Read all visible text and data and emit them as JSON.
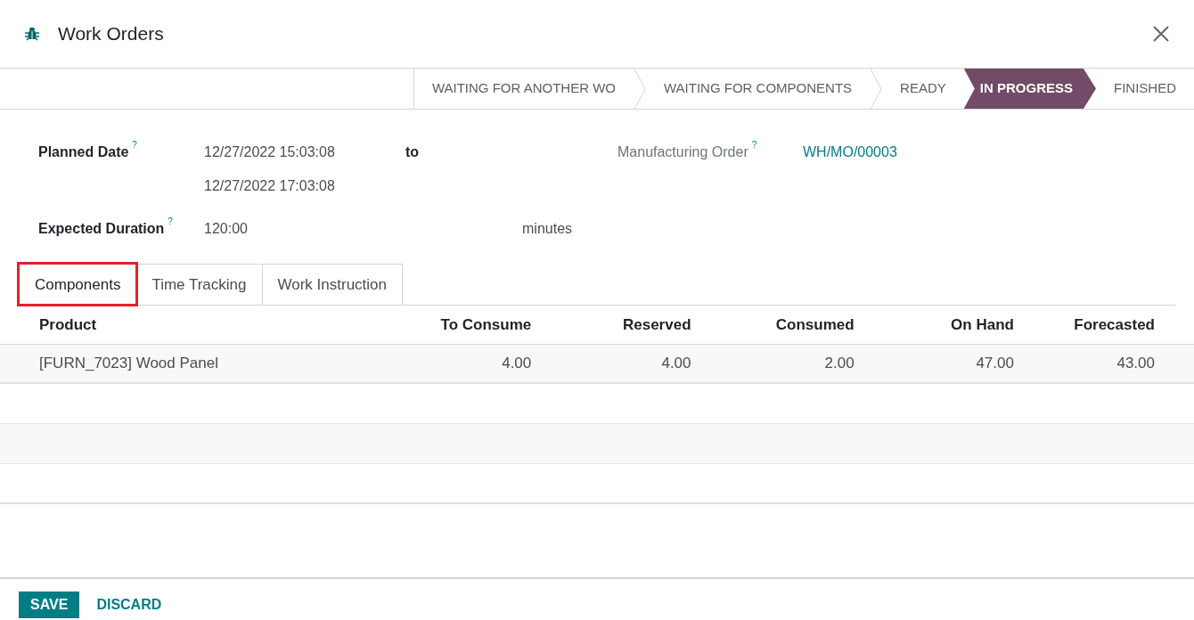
{
  "window": {
    "title": "Work Orders"
  },
  "stages": [
    {
      "label": "WAITING FOR ANOTHER WO",
      "selected": false
    },
    {
      "label": "WAITING FOR COMPONENTS",
      "selected": false
    },
    {
      "label": "READY",
      "selected": false
    },
    {
      "label": "IN PROGRESS",
      "selected": true
    },
    {
      "label": "FINISHED",
      "selected": false
    }
  ],
  "form": {
    "planned_date": {
      "label": "Planned Date",
      "help": "?",
      "start": "12/27/2022 15:03:08",
      "separator": "to",
      "end": "12/27/2022 17:03:08"
    },
    "manufacturing_order": {
      "label": "Manufacturing Order",
      "help": "?",
      "value": "WH/MO/00003"
    },
    "expected_duration": {
      "label": "Expected Duration",
      "help": "?",
      "value": "120:00",
      "unit": "minutes"
    }
  },
  "tabs": [
    {
      "label": "Components",
      "selected": true,
      "highlighted": true
    },
    {
      "label": "Time Tracking",
      "selected": false,
      "highlighted": false
    },
    {
      "label": "Work Instruction",
      "selected": false,
      "highlighted": false
    }
  ],
  "table": {
    "columns": [
      "Product",
      "To Consume",
      "Reserved",
      "Consumed",
      "On Hand",
      "Forecasted"
    ],
    "rows": [
      [
        "[FURN_7023] Wood Panel",
        "4.00",
        "4.00",
        "2.00",
        "47.00",
        "43.00"
      ]
    ]
  },
  "buttons": [
    {
      "label": "SAVE",
      "kind": "primary"
    },
    {
      "label": "DISCARD",
      "kind": "link"
    }
  ]
}
